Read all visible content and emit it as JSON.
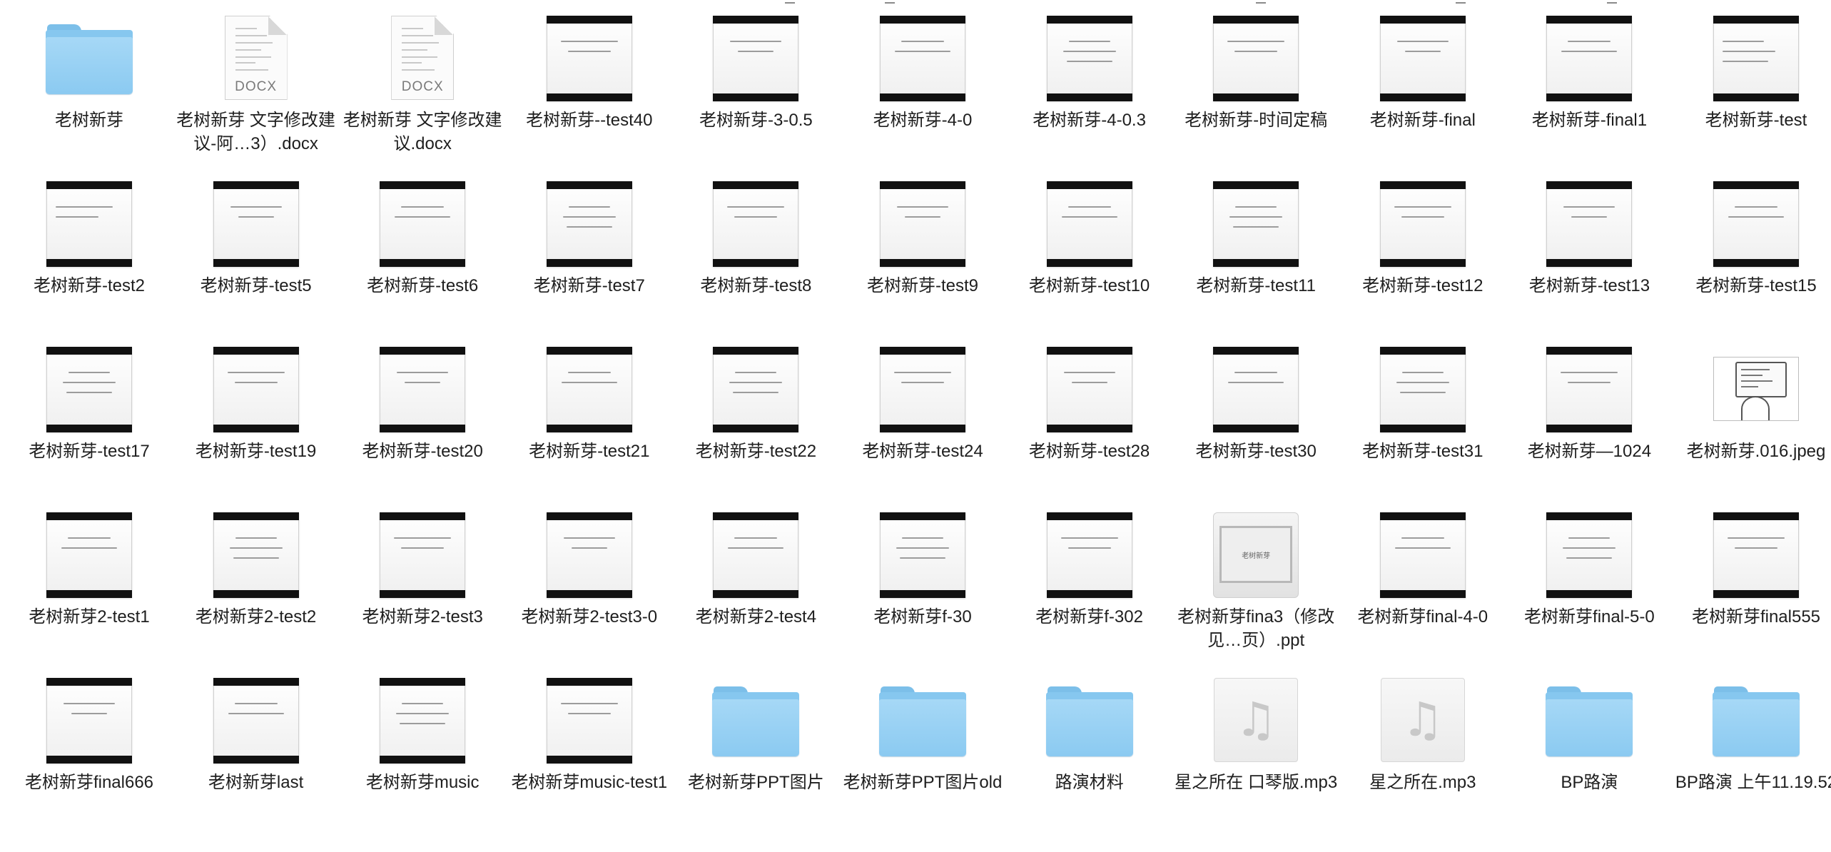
{
  "window": {
    "title": ""
  },
  "files": [
    {
      "name": "老树新芽",
      "kind": "folder"
    },
    {
      "name": "老树新芽 文字修改建议-阿…3）.docx",
      "kind": "docx",
      "badge": "DOCX"
    },
    {
      "name": "老树新芽 文字修改建议.docx",
      "kind": "docx",
      "badge": "DOCX"
    },
    {
      "name": "老树新芽--test40",
      "kind": "slide"
    },
    {
      "name": "老树新芽-3-0.5",
      "kind": "slide"
    },
    {
      "name": "老树新芽-4-0",
      "kind": "slide"
    },
    {
      "name": "老树新芽-4-0.3",
      "kind": "slide"
    },
    {
      "name": "老树新芽-时间定稿",
      "kind": "slide"
    },
    {
      "name": "老树新芽-final",
      "kind": "slide"
    },
    {
      "name": "老树新芽-final1",
      "kind": "slide"
    },
    {
      "name": "老树新芽-test",
      "kind": "slide"
    },
    {
      "name": "老树新芽-test2",
      "kind": "slide"
    },
    {
      "name": "老树新芽-test5",
      "kind": "slide"
    },
    {
      "name": "老树新芽-test6",
      "kind": "slide"
    },
    {
      "name": "老树新芽-test7",
      "kind": "slide"
    },
    {
      "name": "老树新芽-test8",
      "kind": "slide"
    },
    {
      "name": "老树新芽-test9",
      "kind": "slide"
    },
    {
      "name": "老树新芽-test10",
      "kind": "slide"
    },
    {
      "name": "老树新芽-test11",
      "kind": "slide"
    },
    {
      "name": "老树新芽-test12",
      "kind": "slide"
    },
    {
      "name": "老树新芽-test13",
      "kind": "slide"
    },
    {
      "name": "老树新芽-test15",
      "kind": "slide"
    },
    {
      "name": "老树新芽-test17",
      "kind": "slide"
    },
    {
      "name": "老树新芽-test19",
      "kind": "slide"
    },
    {
      "name": "老树新芽-test20",
      "kind": "slide"
    },
    {
      "name": "老树新芽-test21",
      "kind": "slide"
    },
    {
      "name": "老树新芽-test22",
      "kind": "slide"
    },
    {
      "name": "老树新芽-test24",
      "kind": "slide"
    },
    {
      "name": "老树新芽-test28",
      "kind": "slide"
    },
    {
      "name": "老树新芽-test30",
      "kind": "slide"
    },
    {
      "name": "老树新芽-test31",
      "kind": "slide"
    },
    {
      "name": "老树新芽—1024",
      "kind": "slide"
    },
    {
      "name": "老树新芽.016.jpeg",
      "kind": "jpeg"
    },
    {
      "name": "老树新芽2-test1",
      "kind": "slide"
    },
    {
      "name": "老树新芽2-test2",
      "kind": "slide"
    },
    {
      "name": "老树新芽2-test3",
      "kind": "slide"
    },
    {
      "name": "老树新芽2-test3-0",
      "kind": "slide"
    },
    {
      "name": "老树新芽2-test4",
      "kind": "slide"
    },
    {
      "name": "老树新芽f-30",
      "kind": "slide"
    },
    {
      "name": "老树新芽f-302",
      "kind": "slide"
    },
    {
      "name": "老树新芽fina3（修改见…页）.ppt",
      "kind": "ppt",
      "thumb_text": "老树新芽"
    },
    {
      "name": "老树新芽final-4-0",
      "kind": "slide"
    },
    {
      "name": "老树新芽final-5-0",
      "kind": "slide"
    },
    {
      "name": "老树新芽final555",
      "kind": "slide"
    },
    {
      "name": "老树新芽final666",
      "kind": "slide"
    },
    {
      "name": "老树新芽last",
      "kind": "slide"
    },
    {
      "name": "老树新芽music",
      "kind": "slide"
    },
    {
      "name": "老树新芽music-test1",
      "kind": "slide"
    },
    {
      "name": "老树新芽PPT图片",
      "kind": "folder"
    },
    {
      "name": "老树新芽PPT图片old",
      "kind": "folder"
    },
    {
      "name": "路演材料",
      "kind": "folder"
    },
    {
      "name": "星之所在 口琴版.mp3",
      "kind": "mp3"
    },
    {
      "name": "星之所在.mp3",
      "kind": "mp3"
    },
    {
      "name": "BP路演",
      "kind": "folder"
    },
    {
      "name": "BP路演 上午11.19.52",
      "kind": "folder"
    }
  ]
}
